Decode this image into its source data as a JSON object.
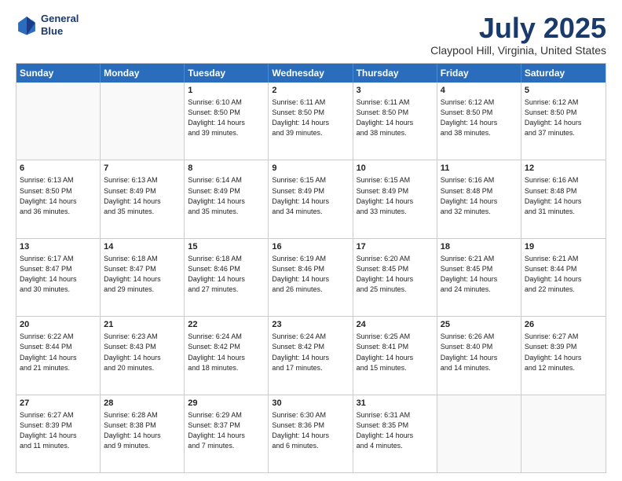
{
  "header": {
    "logo_line1": "General",
    "logo_line2": "Blue",
    "month": "July 2025",
    "location": "Claypool Hill, Virginia, United States"
  },
  "days_of_week": [
    "Sunday",
    "Monday",
    "Tuesday",
    "Wednesday",
    "Thursday",
    "Friday",
    "Saturday"
  ],
  "weeks": [
    [
      {
        "day": "",
        "info": ""
      },
      {
        "day": "",
        "info": ""
      },
      {
        "day": "1",
        "info": "Sunrise: 6:10 AM\nSunset: 8:50 PM\nDaylight: 14 hours\nand 39 minutes."
      },
      {
        "day": "2",
        "info": "Sunrise: 6:11 AM\nSunset: 8:50 PM\nDaylight: 14 hours\nand 39 minutes."
      },
      {
        "day": "3",
        "info": "Sunrise: 6:11 AM\nSunset: 8:50 PM\nDaylight: 14 hours\nand 38 minutes."
      },
      {
        "day": "4",
        "info": "Sunrise: 6:12 AM\nSunset: 8:50 PM\nDaylight: 14 hours\nand 38 minutes."
      },
      {
        "day": "5",
        "info": "Sunrise: 6:12 AM\nSunset: 8:50 PM\nDaylight: 14 hours\nand 37 minutes."
      }
    ],
    [
      {
        "day": "6",
        "info": "Sunrise: 6:13 AM\nSunset: 8:50 PM\nDaylight: 14 hours\nand 36 minutes."
      },
      {
        "day": "7",
        "info": "Sunrise: 6:13 AM\nSunset: 8:49 PM\nDaylight: 14 hours\nand 35 minutes."
      },
      {
        "day": "8",
        "info": "Sunrise: 6:14 AM\nSunset: 8:49 PM\nDaylight: 14 hours\nand 35 minutes."
      },
      {
        "day": "9",
        "info": "Sunrise: 6:15 AM\nSunset: 8:49 PM\nDaylight: 14 hours\nand 34 minutes."
      },
      {
        "day": "10",
        "info": "Sunrise: 6:15 AM\nSunset: 8:49 PM\nDaylight: 14 hours\nand 33 minutes."
      },
      {
        "day": "11",
        "info": "Sunrise: 6:16 AM\nSunset: 8:48 PM\nDaylight: 14 hours\nand 32 minutes."
      },
      {
        "day": "12",
        "info": "Sunrise: 6:16 AM\nSunset: 8:48 PM\nDaylight: 14 hours\nand 31 minutes."
      }
    ],
    [
      {
        "day": "13",
        "info": "Sunrise: 6:17 AM\nSunset: 8:47 PM\nDaylight: 14 hours\nand 30 minutes."
      },
      {
        "day": "14",
        "info": "Sunrise: 6:18 AM\nSunset: 8:47 PM\nDaylight: 14 hours\nand 29 minutes."
      },
      {
        "day": "15",
        "info": "Sunrise: 6:18 AM\nSunset: 8:46 PM\nDaylight: 14 hours\nand 27 minutes."
      },
      {
        "day": "16",
        "info": "Sunrise: 6:19 AM\nSunset: 8:46 PM\nDaylight: 14 hours\nand 26 minutes."
      },
      {
        "day": "17",
        "info": "Sunrise: 6:20 AM\nSunset: 8:45 PM\nDaylight: 14 hours\nand 25 minutes."
      },
      {
        "day": "18",
        "info": "Sunrise: 6:21 AM\nSunset: 8:45 PM\nDaylight: 14 hours\nand 24 minutes."
      },
      {
        "day": "19",
        "info": "Sunrise: 6:21 AM\nSunset: 8:44 PM\nDaylight: 14 hours\nand 22 minutes."
      }
    ],
    [
      {
        "day": "20",
        "info": "Sunrise: 6:22 AM\nSunset: 8:44 PM\nDaylight: 14 hours\nand 21 minutes."
      },
      {
        "day": "21",
        "info": "Sunrise: 6:23 AM\nSunset: 8:43 PM\nDaylight: 14 hours\nand 20 minutes."
      },
      {
        "day": "22",
        "info": "Sunrise: 6:24 AM\nSunset: 8:42 PM\nDaylight: 14 hours\nand 18 minutes."
      },
      {
        "day": "23",
        "info": "Sunrise: 6:24 AM\nSunset: 8:42 PM\nDaylight: 14 hours\nand 17 minutes."
      },
      {
        "day": "24",
        "info": "Sunrise: 6:25 AM\nSunset: 8:41 PM\nDaylight: 14 hours\nand 15 minutes."
      },
      {
        "day": "25",
        "info": "Sunrise: 6:26 AM\nSunset: 8:40 PM\nDaylight: 14 hours\nand 14 minutes."
      },
      {
        "day": "26",
        "info": "Sunrise: 6:27 AM\nSunset: 8:39 PM\nDaylight: 14 hours\nand 12 minutes."
      }
    ],
    [
      {
        "day": "27",
        "info": "Sunrise: 6:27 AM\nSunset: 8:39 PM\nDaylight: 14 hours\nand 11 minutes."
      },
      {
        "day": "28",
        "info": "Sunrise: 6:28 AM\nSunset: 8:38 PM\nDaylight: 14 hours\nand 9 minutes."
      },
      {
        "day": "29",
        "info": "Sunrise: 6:29 AM\nSunset: 8:37 PM\nDaylight: 14 hours\nand 7 minutes."
      },
      {
        "day": "30",
        "info": "Sunrise: 6:30 AM\nSunset: 8:36 PM\nDaylight: 14 hours\nand 6 minutes."
      },
      {
        "day": "31",
        "info": "Sunrise: 6:31 AM\nSunset: 8:35 PM\nDaylight: 14 hours\nand 4 minutes."
      },
      {
        "day": "",
        "info": ""
      },
      {
        "day": "",
        "info": ""
      }
    ]
  ]
}
